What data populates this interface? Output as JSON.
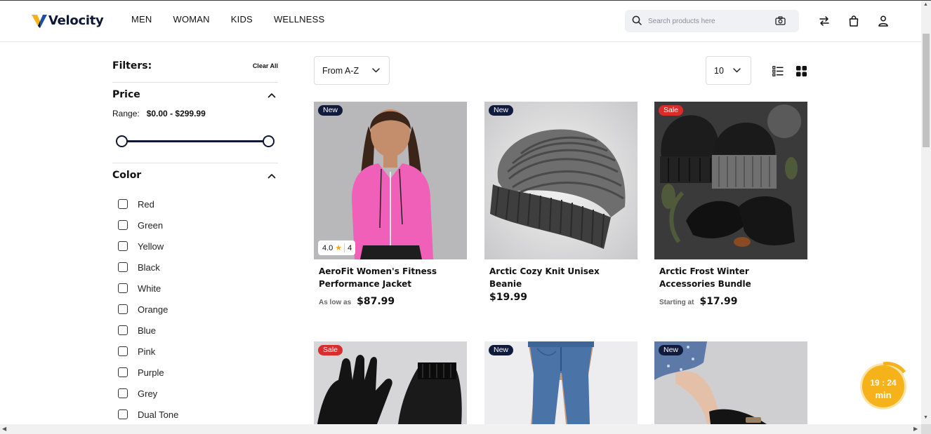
{
  "brand": {
    "name": "Velocity",
    "accent": "#f5b21a",
    "navy": "#0e1733"
  },
  "nav": [
    "MEN",
    "WOMAN",
    "KIDS",
    "WELLNESS"
  ],
  "search": {
    "placeholder": "Search products here"
  },
  "filters": {
    "title": "Filters:",
    "clear_label": "Clear All",
    "price": {
      "title": "Price",
      "range_label": "Range:",
      "range_value": "$0.00 - $299.99"
    },
    "color": {
      "title": "Color",
      "options": [
        "Red",
        "Green",
        "Yellow",
        "Black",
        "White",
        "Orange",
        "Blue",
        "Pink",
        "Purple",
        "Grey",
        "Dual Tone"
      ]
    }
  },
  "toolbar": {
    "sort_value": "From A-Z",
    "per_page_value": "10"
  },
  "products": [
    {
      "badge": "New",
      "name": "AeroFit Women's Fitness Performance Jacket",
      "price_prefix": "As low as",
      "price": "$87.99",
      "rating": "4.0",
      "reviews": "4"
    },
    {
      "badge": "New",
      "name": "Arctic Cozy Knit Unisex Beanie",
      "price_prefix": "",
      "price": "$19.99"
    },
    {
      "badge": "Sale",
      "name": "Arctic Frost Winter Accessories Bundle",
      "price_prefix": "Starting at",
      "price": "$17.99"
    },
    {
      "badge": "Sale"
    },
    {
      "badge": "New"
    },
    {
      "badge": "New"
    }
  ],
  "timer": {
    "time": "19 : 24",
    "unit": "min"
  }
}
